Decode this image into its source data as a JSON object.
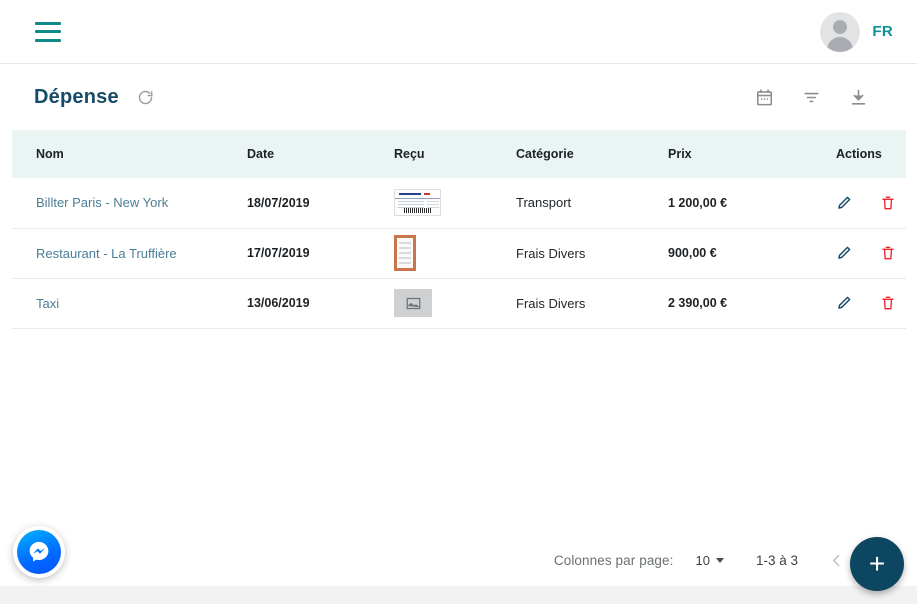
{
  "topbar": {
    "menu_icon": "hamburger-menu-icon",
    "avatar_icon": "user-avatar-icon",
    "language": "FR"
  },
  "page": {
    "title": "Dépense",
    "refresh_icon": "refresh-icon",
    "tools": [
      {
        "name": "calendar-icon",
        "label": "Calendrier"
      },
      {
        "name": "filter-icon",
        "label": "Filtre"
      },
      {
        "name": "download-icon",
        "label": "Télécharger"
      }
    ]
  },
  "table": {
    "columns": [
      "Nom",
      "Date",
      "Reçu",
      "Catégorie",
      "Prix",
      "Actions"
    ],
    "rows": [
      {
        "nom": "Billter Paris - New York",
        "date": "18/07/2019",
        "recu": "ticket-thumbnail",
        "categorie": "Transport",
        "prix": "1 200,00 €",
        "edit_icon": "edit-pencil-icon",
        "delete_icon": "delete-trash-icon"
      },
      {
        "nom": "Restaurant - La Truffière",
        "date": "17/07/2019",
        "recu": "receipt-thumbnail",
        "categorie": "Frais Divers",
        "prix": "900,00 €",
        "edit_icon": "edit-pencil-icon",
        "delete_icon": "delete-trash-icon"
      },
      {
        "nom": "Taxi",
        "date": "13/06/2019",
        "recu": "image-placeholder",
        "categorie": "Frais Divers",
        "prix": "2 390,00 €",
        "edit_icon": "edit-pencil-icon",
        "delete_icon": "delete-trash-icon"
      }
    ]
  },
  "footer": {
    "rows_per_page_label": "Colonnes par page:",
    "rows_per_page_value": "10",
    "range": "1-3 à 3",
    "prev_icon": "chevron-left-icon",
    "add_button": "+"
  },
  "widgets": {
    "messenger": "messenger-bubble-icon"
  },
  "colors": {
    "accent_teal": "#0d9396",
    "title_navy": "#174b68",
    "header_bg": "#e9f4f3",
    "link": "#4b7e95",
    "delete_red": "#f0222a",
    "fab_navy": "#0d4660"
  }
}
